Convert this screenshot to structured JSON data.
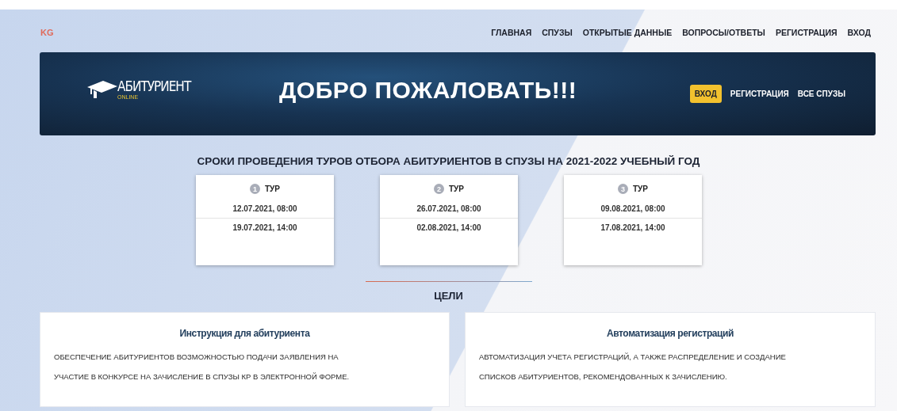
{
  "brand": "KG",
  "nav": [
    "ГЛАВНАЯ",
    "СПУЗЫ",
    "ОТКРЫТЫЕ ДАННЫЕ",
    "ВОПРОСЫ/ОТВЕТЫ",
    "РЕГИСТРАЦИЯ",
    "ВХОД"
  ],
  "banner": {
    "logo": {
      "name": "АБИТУРИЕНТ",
      "sub": "ONLINE"
    },
    "title": "ДОБРО ПОЖАЛОВАТЬ!!!",
    "actions": [
      {
        "label": "ВХОД",
        "kind": "primary"
      },
      {
        "label": "РЕГИСТРАЦИЯ",
        "kind": "link"
      },
      {
        "label": "ВСЕ СПУЗЫ",
        "kind": "link"
      }
    ]
  },
  "schedule": {
    "title": "СРОКИ ПРОВЕДЕНИЯ ТУРОВ ОТБОРА АБИТУРИЕНТОВ В СПУЗЫ НА 2021-2022 УЧЕБНЫЙ ГОД",
    "tours": [
      {
        "number": "1",
        "label": "ТУР",
        "start": "12.07.2021, 08:00",
        "end": "19.07.2021, 14:00"
      },
      {
        "number": "2",
        "label": "ТУР",
        "start": "26.07.2021, 08:00",
        "end": "02.08.2021, 14:00"
      },
      {
        "number": "3",
        "label": "ТУР",
        "start": "09.08.2021, 08:00",
        "end": "17.08.2021, 14:00"
      }
    ]
  },
  "goals": {
    "title": "ЦЕЛИ",
    "items": [
      {
        "heading": "Инструкция для абитуриента",
        "lines": [
          "ОБЕСПЕЧЕНИЕ АБИТУРИЕНТОВ ВОЗМОЖНОСТЬЮ ПОДАЧИ ЗАЯВЛЕНИЯ НА",
          "УЧАСТИЕ В КОНКУРСЕ НА ЗАЧИСЛЕНИЕ В СПУЗЫ КР В ЭЛЕКТРОННОЙ ФОРМЕ."
        ]
      },
      {
        "heading": "Автоматизация регистраций",
        "lines": [
          "АВТОМАТИЗАЦИЯ УЧЕТА РЕГИСТРАЦИЙ, А ТАКЖЕ РАСПРЕДЕЛЕНИЕ И СОЗДАНИЕ",
          "СПИСКОВ АБИТУРИЕНТОВ, РЕКОМЕНДОВАННЫХ К ЗАЧИСЛЕНИЮ."
        ]
      }
    ]
  }
}
